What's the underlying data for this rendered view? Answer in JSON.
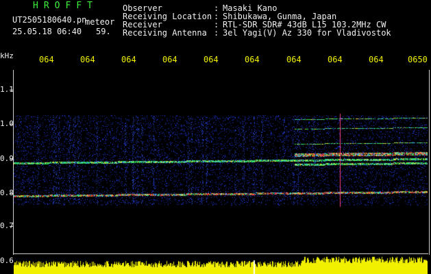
{
  "header": {
    "app_title": "HROFFT",
    "file_name": "UT2505180640.pn",
    "file_tag": "meteor",
    "date_time": "25.05.18 06:40",
    "frame_number": "59.",
    "info": [
      {
        "label": "Observer",
        "value": "Masaki Kano"
      },
      {
        "label": "Receiving Location",
        "value": "Shibukawa, Gunma, Japan"
      },
      {
        "label": "Receiver",
        "value": "RTL-SDR SDR# 43dB L15 103.2MHz CW"
      },
      {
        "label": "Receiving Antenna",
        "value": "3el Yagi(V) Az 330 for Vladivostok"
      }
    ],
    "separator": ":"
  },
  "axis": {
    "y_unit": "kHz",
    "y_ticks": [
      "1.1",
      "1.0",
      "0.9",
      "0.8",
      "0.7",
      "0.6"
    ],
    "x_ticks": [
      "064",
      "064",
      "064",
      "064",
      "064",
      "064",
      "064",
      "064",
      "064",
      "0650"
    ]
  },
  "colors": {
    "title": "#3cf03c",
    "text": "#f0f0f0",
    "axis_labels": "#f0f000",
    "background": "#000000",
    "noise": "#1e28c8",
    "signal": "#ff2020",
    "marker": "#ff4080",
    "power_bars": "#f0f000"
  }
}
